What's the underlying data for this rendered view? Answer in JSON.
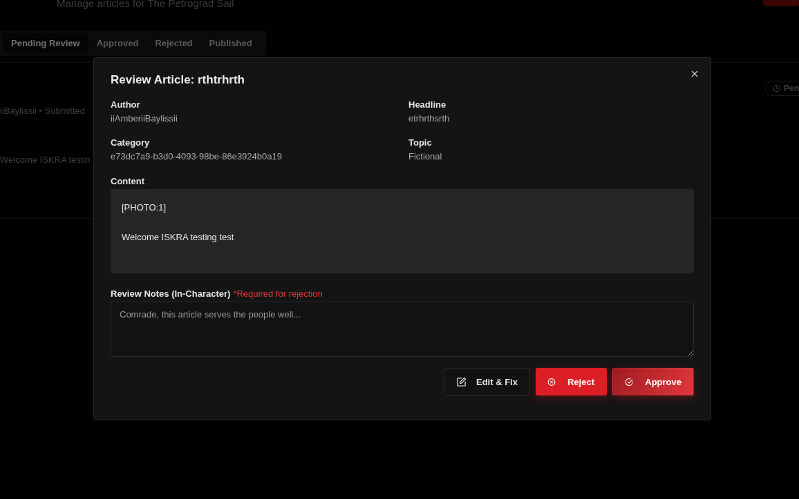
{
  "page": {
    "subtitle": "Manage articles for The Petrograd Sail"
  },
  "tabs": [
    {
      "label": "Pending Review",
      "selected": true
    },
    {
      "label": "Approved",
      "selected": false
    },
    {
      "label": "Rejected",
      "selected": false
    },
    {
      "label": "Published",
      "selected": false
    }
  ],
  "article_row": {
    "meta": "iiBaylissii • Submitted",
    "excerpt": "Welcome ISKRA testin",
    "status": "Pen"
  },
  "dialog": {
    "title": "Review Article: rthtrhrth",
    "fields": [
      {
        "label": "Author",
        "value": "iiAmberiiBaylissii"
      },
      {
        "label": "Headline",
        "value": "etrhrthsrth"
      },
      {
        "label": "Category",
        "value": "e73dc7a9-b3d0-4093-98be-86e3924b0a19"
      },
      {
        "label": "Topic",
        "value": "Fictional"
      }
    ],
    "content": {
      "label": "Content",
      "paragraphs": [
        "[PHOTO:1]",
        "Welcome ISKRA testing test"
      ]
    },
    "notes": {
      "label": "Review Notes (In-Character)",
      "required": "*Required for rejection",
      "placeholder": "Comrade, this article serves the people well..."
    },
    "buttons": [
      {
        "label": "Edit & Fix",
        "kind": "edit"
      },
      {
        "label": "Reject",
        "kind": "reject"
      },
      {
        "label": "Approve",
        "kind": "approve"
      }
    ]
  }
}
